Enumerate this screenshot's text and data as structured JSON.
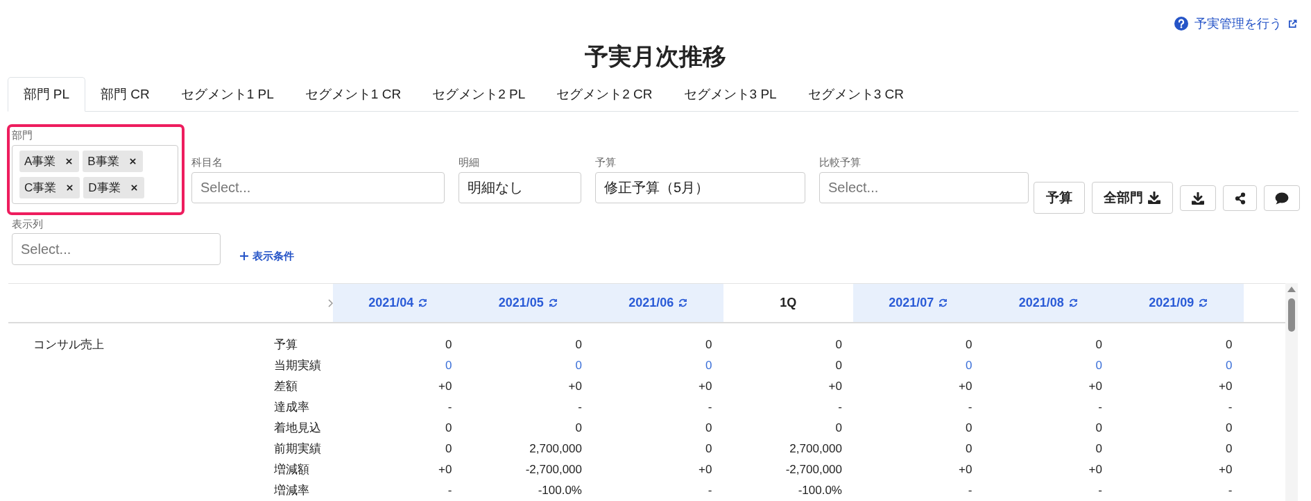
{
  "help_link": {
    "label": "予実管理を行う"
  },
  "title": "予実月次推移",
  "tabs": [
    {
      "label": "部門 PL",
      "selected": true
    },
    {
      "label": "部門 CR",
      "selected": false
    },
    {
      "label": "セグメント1 PL",
      "selected": false
    },
    {
      "label": "セグメント1 CR",
      "selected": false
    },
    {
      "label": "セグメント2 PL",
      "selected": false
    },
    {
      "label": "セグメント2 CR",
      "selected": false
    },
    {
      "label": "セグメント3 PL",
      "selected": false
    },
    {
      "label": "セグメント3 CR",
      "selected": false
    }
  ],
  "filters": [
    {
      "kind": "multi",
      "label": "部門",
      "highlighted": true,
      "chips": [
        "A事業",
        "B事業",
        "C事業",
        "D事業"
      ]
    },
    {
      "kind": "single",
      "label": "科目名",
      "highlighted": false,
      "placeholder": "Select..."
    },
    {
      "kind": "single",
      "label": "明細",
      "highlighted": false,
      "value": "明細なし"
    },
    {
      "kind": "single",
      "label": "予算",
      "highlighted": false,
      "value": "修正予算（5月）"
    },
    {
      "kind": "single",
      "label": "比較予算",
      "highlighted": false,
      "placeholder": "Select..."
    }
  ],
  "buttons": [
    {
      "kind": "text",
      "label": "予算"
    },
    {
      "kind": "text_icon",
      "label": "全部門"
    }
  ],
  "column_filter": {
    "label": "表示列",
    "placeholder": "Select..."
  },
  "add_condition": {
    "label": "表示条件"
  },
  "table": {
    "columns": [
      {
        "kind": "month",
        "label": "2021/04"
      },
      {
        "kind": "month",
        "label": "2021/05"
      },
      {
        "kind": "month",
        "label": "2021/06"
      },
      {
        "kind": "quarter",
        "label": "1Q"
      },
      {
        "kind": "month",
        "label": "2021/07"
      },
      {
        "kind": "month",
        "label": "2021/08"
      },
      {
        "kind": "month",
        "label": "2021/09"
      }
    ],
    "groups": [
      {
        "label": "コンサル売上",
        "rows": [
          {
            "label": "予算",
            "cells": [
              {
                "text": "0",
                "link": false
              },
              {
                "text": "0",
                "link": false
              },
              {
                "text": "0",
                "link": false
              },
              {
                "text": "0",
                "link": false
              },
              {
                "text": "0",
                "link": false
              },
              {
                "text": "0",
                "link": false
              },
              {
                "text": "0",
                "link": false
              }
            ]
          },
          {
            "label": "当期実績",
            "cells": [
              {
                "text": "0",
                "link": true
              },
              {
                "text": "0",
                "link": true
              },
              {
                "text": "0",
                "link": true
              },
              {
                "text": "0",
                "link": false
              },
              {
                "text": "0",
                "link": true
              },
              {
                "text": "0",
                "link": true
              },
              {
                "text": "0",
                "link": true
              }
            ]
          },
          {
            "label": "差額",
            "cells": [
              {
                "text": "+0",
                "link": false
              },
              {
                "text": "+0",
                "link": false
              },
              {
                "text": "+0",
                "link": false
              },
              {
                "text": "+0",
                "link": false
              },
              {
                "text": "+0",
                "link": false
              },
              {
                "text": "+0",
                "link": false
              },
              {
                "text": "+0",
                "link": false
              }
            ]
          },
          {
            "label": "達成率",
            "cells": [
              {
                "text": "-",
                "link": false
              },
              {
                "text": "-",
                "link": false
              },
              {
                "text": "-",
                "link": false
              },
              {
                "text": "-",
                "link": false
              },
              {
                "text": "-",
                "link": false
              },
              {
                "text": "-",
                "link": false
              },
              {
                "text": "-",
                "link": false
              }
            ]
          },
          {
            "label": "着地見込",
            "cells": [
              {
                "text": "0",
                "link": false
              },
              {
                "text": "0",
                "link": false
              },
              {
                "text": "0",
                "link": false
              },
              {
                "text": "0",
                "link": false
              },
              {
                "text": "0",
                "link": false
              },
              {
                "text": "0",
                "link": false
              },
              {
                "text": "0",
                "link": false
              }
            ]
          },
          {
            "label": "前期実績",
            "cells": [
              {
                "text": "0",
                "link": false
              },
              {
                "text": "2,700,000",
                "link": false
              },
              {
                "text": "0",
                "link": false
              },
              {
                "text": "2,700,000",
                "link": false
              },
              {
                "text": "0",
                "link": false
              },
              {
                "text": "0",
                "link": false
              },
              {
                "text": "0",
                "link": false
              }
            ]
          },
          {
            "label": "増減額",
            "cells": [
              {
                "text": "+0",
                "link": false
              },
              {
                "text": "-2,700,000",
                "link": false
              },
              {
                "text": "+0",
                "link": false
              },
              {
                "text": "-2,700,000",
                "link": false
              },
              {
                "text": "+0",
                "link": false
              },
              {
                "text": "+0",
                "link": false
              },
              {
                "text": "+0",
                "link": false
              }
            ]
          },
          {
            "label": "増減率",
            "cells": [
              {
                "text": "-",
                "link": false
              },
              {
                "text": "-100.0%",
                "link": false
              },
              {
                "text": "-",
                "link": false
              },
              {
                "text": "-100.0%",
                "link": false
              },
              {
                "text": "-",
                "link": false
              },
              {
                "text": "-",
                "link": false
              },
              {
                "text": "-",
                "link": false
              }
            ]
          }
        ]
      }
    ]
  }
}
